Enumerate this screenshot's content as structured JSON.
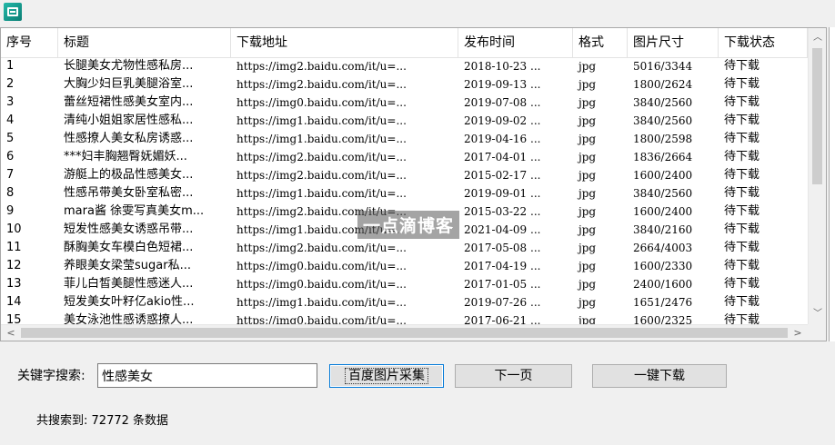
{
  "table": {
    "columns": [
      "序号",
      "标题",
      "下载地址",
      "发布时间",
      "格式",
      "图片尺寸",
      "下载状态"
    ],
    "rows": [
      [
        "1",
        "长腿美女尤物性感私房...",
        "https://img2.baidu.com/it/u=...",
        "2018-10-23 ...",
        "jpg",
        "5016/3344",
        "待下载"
      ],
      [
        "2",
        "大胸少妇巨乳美腿浴室...",
        "https://img2.baidu.com/it/u=...",
        "2019-09-13 ...",
        "jpg",
        "1800/2624",
        "待下载"
      ],
      [
        "3",
        "蕾丝短裙性感美女室内...",
        "https://img0.baidu.com/it/u=...",
        "2019-07-08 ...",
        "jpg",
        "3840/2560",
        "待下载"
      ],
      [
        "4",
        "清纯小姐姐家居性感私...",
        "https://img1.baidu.com/it/u=...",
        "2019-09-02 ...",
        "jpg",
        "3840/2560",
        "待下载"
      ],
      [
        "5",
        "性感撩人美女私房诱惑...",
        "https://img1.baidu.com/it/u=...",
        "2019-04-16 ...",
        "jpg",
        "1800/2598",
        "待下载"
      ],
      [
        "6",
        "***妇丰胸翘臀妩媚妖...",
        "https://img2.baidu.com/it/u=...",
        "2017-04-01 ...",
        "jpg",
        "1836/2664",
        "待下载"
      ],
      [
        "7",
        "游艇上的极品性感美女...",
        "https://img2.baidu.com/it/u=...",
        "2015-02-17 ...",
        "jpg",
        "1600/2400",
        "待下载"
      ],
      [
        "8",
        "性感吊带美女卧室私密...",
        "https://img1.baidu.com/it/u=...",
        "2019-09-01 ...",
        "jpg",
        "3840/2560",
        "待下载"
      ],
      [
        "9",
        "mara酱 徐雯写真美女m...",
        "https://img2.baidu.com/it/u=...",
        "2015-03-22 ...",
        "jpg",
        "1600/2400",
        "待下载"
      ],
      [
        "10",
        "短发性感美女诱惑吊带...",
        "https://img1.baidu.com/it/u=...",
        "2021-04-09 ...",
        "jpg",
        "3840/2160",
        "待下载"
      ],
      [
        "11",
        "酥胸美女车模白色短裙...",
        "https://img2.baidu.com/it/u=...",
        "2017-05-08 ...",
        "jpg",
        "2664/4003",
        "待下载"
      ],
      [
        "12",
        "养眼美女梁莹sugar私...",
        "https://img0.baidu.com/it/u=...",
        "2017-04-19 ...",
        "jpg",
        "1600/2330",
        "待下载"
      ],
      [
        "13",
        "菲儿白皙美腿性感迷人...",
        "https://img0.baidu.com/it/u=...",
        "2017-01-05 ...",
        "jpg",
        "2400/1600",
        "待下载"
      ],
      [
        "14",
        "短发美女叶籽亿akio性...",
        "https://img1.baidu.com/it/u=...",
        "2019-07-26 ...",
        "jpg",
        "1651/2476",
        "待下载"
      ],
      [
        "15",
        "美女泳池性感诱惑撩人...",
        "https://img0.baidu.com/it/u=...",
        "2017-06-21 ...",
        "jpg",
        "1600/2325",
        "待下载"
      ]
    ]
  },
  "scroll": {
    "up": "︿",
    "down": "﹀",
    "left": "<",
    "right": ">"
  },
  "watermark": "一点滴博客",
  "search": {
    "label": "关键字搜索:",
    "value": "性感美女"
  },
  "buttons": {
    "collect": "百度图片采集",
    "next": "下一页",
    "download_all": "一键下载"
  },
  "status": {
    "prefix": "共搜索到:",
    "count": "72772",
    "suffix": "条数据"
  },
  "icons": {
    "app": "app-window-icon"
  }
}
